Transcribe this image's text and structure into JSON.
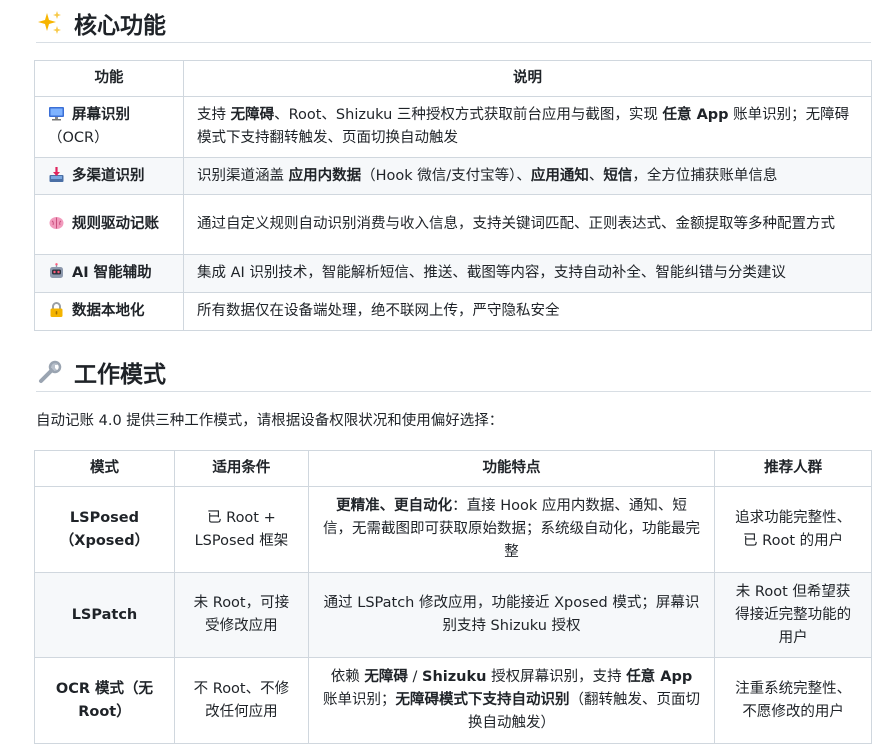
{
  "section1": {
    "title": "核心功能",
    "icon": "sparkles-icon",
    "headers": [
      "功能",
      "说明"
    ],
    "rows": [
      {
        "icon": "monitor-icon",
        "feature_a": "屏幕识别",
        "feature_b": "（OCR）",
        "desc_parts": [
          "支持 ",
          "无障碍",
          "、Root、Shizuku 三种授权方式获取前台应用与截图，实现 ",
          "任意 App",
          " 账单识别；无障碍模式下支持翻转触发、页面切换自动触发"
        ]
      },
      {
        "icon": "inbox-tray-icon",
        "feature_a": "多渠道识别",
        "desc_parts": [
          "识别渠道涵盖 ",
          "应用内数据",
          "（Hook 微信/支付宝等）、",
          "应用通知",
          "、",
          "短信",
          "，全方位捕获账单信息"
        ]
      },
      {
        "icon": "brain-icon",
        "feature_a": "规则驱动记账",
        "desc_parts": [
          "通过自定义规则自动识别消费与收入信息，支持关键词匹配、正则表达式、金额提取等多种配置方式"
        ]
      },
      {
        "icon": "robot-icon",
        "feature_a": "AI 智能辅助",
        "desc_parts": [
          "集成 AI 识别技术，智能解析短信、推送、截图等内容，支持自动补全、智能纠错与分类建议"
        ]
      },
      {
        "icon": "lock-icon",
        "feature_a": "数据本地化",
        "desc_parts": [
          "所有数据仅在设备端处理，绝不联网上传，严守隐私安全"
        ]
      }
    ]
  },
  "section2": {
    "title": "工作模式",
    "icon": "wrench-icon",
    "intro": "自动记账 4.0 提供三种工作模式，请根据设备权限状况和使用偏好选择：",
    "headers": [
      "模式",
      "适用条件",
      "功能特点",
      "推荐人群"
    ],
    "rows": [
      {
        "mode_a": "LSPosed",
        "mode_b": "（Xposed）",
        "cond_a": "已 Root +",
        "cond_b": "LSPosed 框架",
        "feat_parts": [
          "更精准、更自动化",
          "：直接 Hook 应用内数据、通知、短信，无需截图即可获取原始数据；系统级自动化，功能最完整"
        ],
        "who_a": "追求功能完整性、",
        "who_b": "已 Root 的用户"
      },
      {
        "mode_a": "LSPatch",
        "cond_a": "未 Root，可接",
        "cond_b": "受修改应用",
        "feat_parts": [
          "通过 LSPatch 修改应用，功能接近 Xposed 模式；屏幕识别支持 Shizuku 授权"
        ],
        "who_a": "未 Root 但希望获",
        "who_b": "得接近完整功能的",
        "who_c": "用户"
      },
      {
        "mode_a": "OCR 模式（无",
        "mode_b": "Root）",
        "cond_a": "不 Root、不修",
        "cond_b": "改任何应用",
        "feat_parts": [
          "依赖 ",
          "无障碍",
          " / ",
          "Shizuku",
          " 授权屏幕识别，支持 ",
          "任意 App",
          " 账单识别；",
          "无障碍模式下支持自动识别",
          "（翻转触发、页面切换自动触发）"
        ],
        "who_a": "注重系统完整性、",
        "who_b": "不愿修改的用户"
      }
    ]
  }
}
